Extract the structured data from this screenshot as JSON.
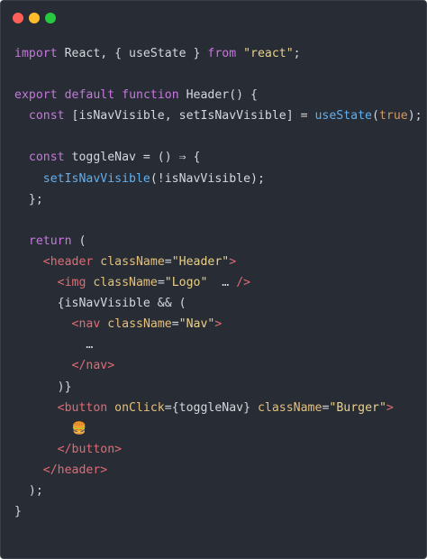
{
  "colors": {
    "background": "#282c34",
    "keyword": "#c678dd",
    "string": "#e9d08b",
    "function": "#61afef",
    "tag": "#e06c75",
    "attribute": "#e5c07b",
    "boolean": "#d19a66",
    "plain": "#d4d7dd",
    "dot_red": "#ff5f56",
    "dot_yellow": "#ffbd2e",
    "dot_green": "#27c93f"
  },
  "window_controls": [
    {
      "name": "close",
      "color": "#ff5f56"
    },
    {
      "name": "minimize",
      "color": "#ffbd2e"
    },
    {
      "name": "maximize",
      "color": "#27c93f"
    }
  ],
  "code_lines": [
    [
      {
        "t": "import",
        "c": "kw"
      },
      {
        "t": " React, { useState } ",
        "c": "plain"
      },
      {
        "t": "from",
        "c": "kw"
      },
      {
        "t": " ",
        "c": "plain"
      },
      {
        "t": "\"react\"",
        "c": "str"
      },
      {
        "t": ";",
        "c": "plain"
      }
    ],
    [],
    [
      {
        "t": "export",
        "c": "kw"
      },
      {
        "t": " ",
        "c": "plain"
      },
      {
        "t": "default",
        "c": "kw"
      },
      {
        "t": " ",
        "c": "plain"
      },
      {
        "t": "function",
        "c": "kw"
      },
      {
        "t": " Header() {",
        "c": "plain"
      }
    ],
    [
      {
        "t": "  ",
        "c": "plain"
      },
      {
        "t": "const",
        "c": "kw"
      },
      {
        "t": " [isNavVisible, setIsNavVisible] = ",
        "c": "plain"
      },
      {
        "t": "useState",
        "c": "fn"
      },
      {
        "t": "(",
        "c": "plain"
      },
      {
        "t": "true",
        "c": "bool"
      },
      {
        "t": ");",
        "c": "plain"
      }
    ],
    [],
    [
      {
        "t": "  ",
        "c": "plain"
      },
      {
        "t": "const",
        "c": "kw"
      },
      {
        "t": " toggleNav = () ⇒ {",
        "c": "plain"
      }
    ],
    [
      {
        "t": "    ",
        "c": "plain"
      },
      {
        "t": "setIsNavVisible",
        "c": "fn"
      },
      {
        "t": "(!isNavVisible);",
        "c": "plain"
      }
    ],
    [
      {
        "t": "  };",
        "c": "plain"
      }
    ],
    [],
    [
      {
        "t": "  ",
        "c": "plain"
      },
      {
        "t": "return",
        "c": "kw"
      },
      {
        "t": " (",
        "c": "plain"
      }
    ],
    [
      {
        "t": "    ",
        "c": "plain"
      },
      {
        "t": "<header",
        "c": "tag"
      },
      {
        "t": " ",
        "c": "plain"
      },
      {
        "t": "className",
        "c": "attr"
      },
      {
        "t": "=",
        "c": "plain"
      },
      {
        "t": "\"Header\"",
        "c": "str"
      },
      {
        "t": ">",
        "c": "tag"
      }
    ],
    [
      {
        "t": "      ",
        "c": "plain"
      },
      {
        "t": "<img",
        "c": "tag"
      },
      {
        "t": " ",
        "c": "plain"
      },
      {
        "t": "className",
        "c": "attr"
      },
      {
        "t": "=",
        "c": "plain"
      },
      {
        "t": "\"Logo\"",
        "c": "str"
      },
      {
        "t": "  … ",
        "c": "plain"
      },
      {
        "t": "/>",
        "c": "tag"
      }
    ],
    [
      {
        "t": "      {isNavVisible && (",
        "c": "plain"
      }
    ],
    [
      {
        "t": "        ",
        "c": "plain"
      },
      {
        "t": "<nav",
        "c": "tag"
      },
      {
        "t": " ",
        "c": "plain"
      },
      {
        "t": "className",
        "c": "attr"
      },
      {
        "t": "=",
        "c": "plain"
      },
      {
        "t": "\"Nav\"",
        "c": "str"
      },
      {
        "t": ">",
        "c": "tag"
      }
    ],
    [
      {
        "t": "          …",
        "c": "plain"
      }
    ],
    [
      {
        "t": "        ",
        "c": "plain"
      },
      {
        "t": "</nav>",
        "c": "tag"
      }
    ],
    [
      {
        "t": "      )}",
        "c": "plain"
      }
    ],
    [
      {
        "t": "      ",
        "c": "plain"
      },
      {
        "t": "<button",
        "c": "tag"
      },
      {
        "t": " ",
        "c": "plain"
      },
      {
        "t": "onClick",
        "c": "attr"
      },
      {
        "t": "={toggleNav} ",
        "c": "plain"
      },
      {
        "t": "className",
        "c": "attr"
      },
      {
        "t": "=",
        "c": "plain"
      },
      {
        "t": "\"Burger\"",
        "c": "str"
      },
      {
        "t": ">",
        "c": "tag"
      }
    ],
    [
      {
        "t": "        ",
        "c": "plain"
      },
      {
        "t": "🍔",
        "c": "emoji"
      }
    ],
    [
      {
        "t": "      ",
        "c": "plain"
      },
      {
        "t": "</button>",
        "c": "tag"
      }
    ],
    [
      {
        "t": "    ",
        "c": "plain"
      },
      {
        "t": "</header>",
        "c": "tag"
      }
    ],
    [
      {
        "t": "  );",
        "c": "plain"
      }
    ],
    [
      {
        "t": "}",
        "c": "plain"
      }
    ]
  ]
}
